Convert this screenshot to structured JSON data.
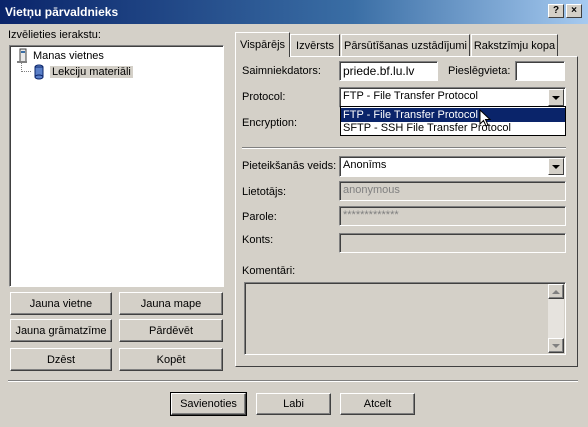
{
  "window": {
    "title": "Vietņu pārvaldnieks",
    "close_glyph": "×",
    "help_glyph": "?"
  },
  "left": {
    "label": "Izvēlieties ierakstu:",
    "tree": [
      {
        "label": "Manas vietnes",
        "icon": "computer-icon"
      },
      {
        "label": "Lekciju materiāli",
        "icon": "server-icon"
      }
    ],
    "buttons": {
      "new_site": "Jauna vietne",
      "new_folder": "Jauna mape",
      "new_bookmark": "Jauna grāmatzīme",
      "rename": "Pārdēvēt",
      "delete": "Dzēst",
      "copy": "Kopēt"
    }
  },
  "tabs": [
    "Vispārējs",
    "Izvērsts",
    "Pārsūtīšanas uzstādījumi",
    "Rakstzīmju kopa"
  ],
  "general": {
    "host_label": "Saimniekdators:",
    "host_value": "priede.bf.lu.lv",
    "port_label": "Pieslēgvieta:",
    "port_value": "",
    "protocol_label": "Protocol:",
    "protocol_value": "FTP - File Transfer Protocol",
    "protocol_options": [
      "FTP - File Transfer Protocol",
      "SFTP - SSH File Transfer Protocol"
    ],
    "encryption_label": "Encryption:",
    "logon_label": "Pieteikšanās veids:",
    "logon_value": "Anonīms",
    "user_label": "Lietotājs:",
    "user_value": "anonymous",
    "password_label": "Parole:",
    "password_value": "*************",
    "account_label": "Konts:",
    "account_value": "",
    "comments_label": "Komentāri:",
    "comments_value": ""
  },
  "footer": {
    "connect": "Savienoties",
    "ok": "Labi",
    "cancel": "Atcelt"
  }
}
